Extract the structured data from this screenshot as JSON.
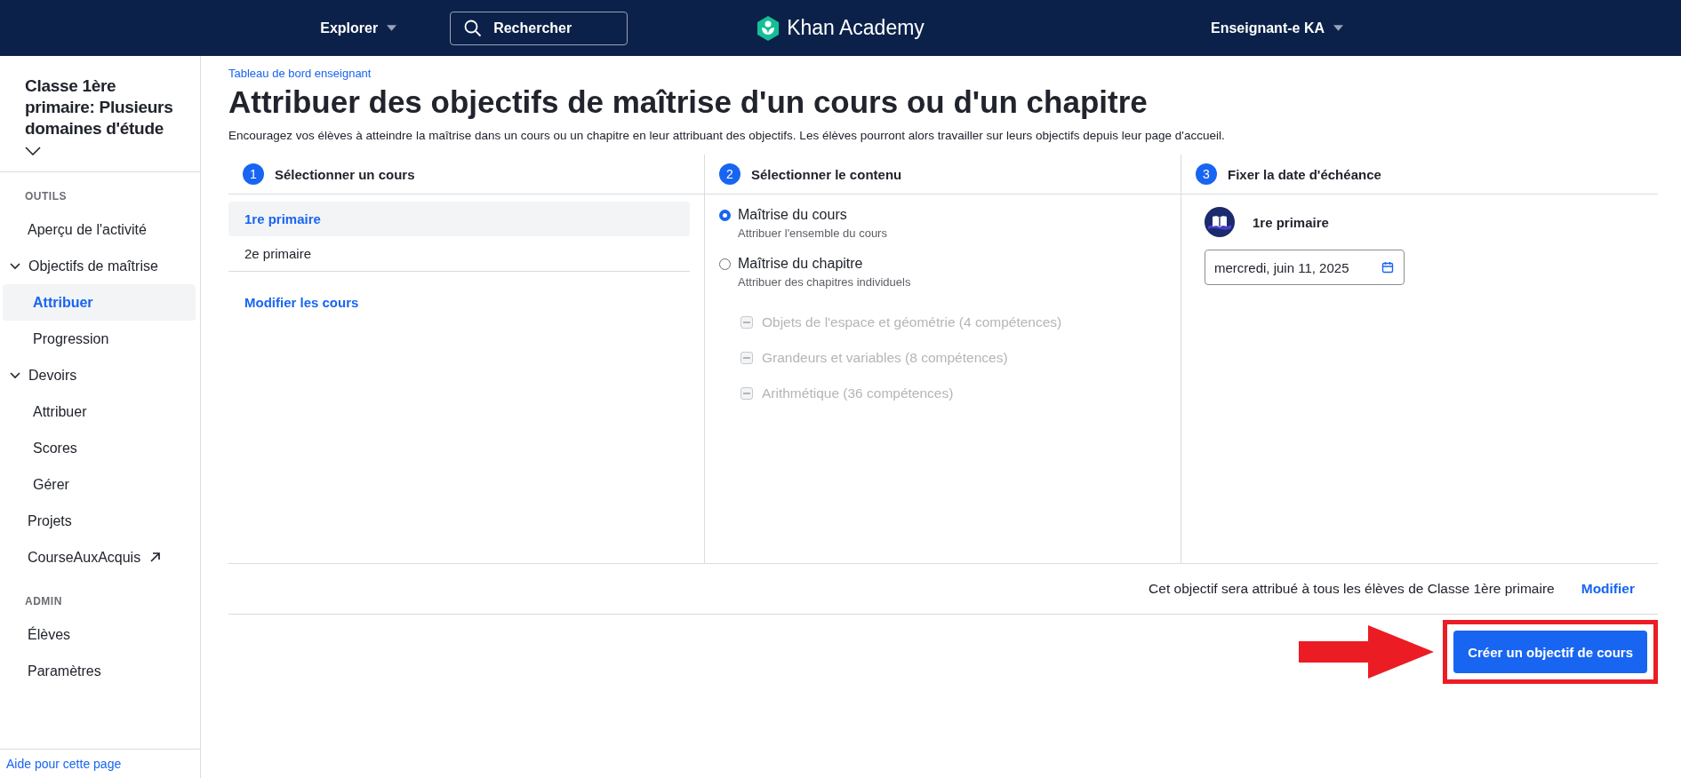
{
  "header": {
    "explore_menu": "Explorer",
    "search": {
      "placeholder": "Rechercher"
    },
    "logo": "Khan Academy",
    "user_menu": "Enseignant-e KA"
  },
  "sidebar": {
    "class_title": "Classe 1ère primaire: Plusieurs domaines d'étude",
    "class_menu_expanded": false,
    "sections": [
      {
        "title": "OUTILS",
        "items": [
          {
            "kind": "link",
            "label": "Aperçu de l'activité",
            "selected": false
          },
          {
            "kind": "group",
            "label": "Objectifs de maîtrise",
            "expanded": true,
            "children": [
              {
                "label": "Attribuer",
                "selected": true
              },
              {
                "label": "Progression",
                "selected": false
              }
            ]
          },
          {
            "kind": "group",
            "label": "Devoirs",
            "expanded": true,
            "children": [
              {
                "label": "Attribuer",
                "selected": false
              },
              {
                "label": "Scores",
                "selected": false
              },
              {
                "label": "Gérer",
                "selected": false
              }
            ]
          },
          {
            "kind": "link",
            "label": "Projets",
            "selected": false
          },
          {
            "kind": "external",
            "label": "CourseAuxAcquis",
            "selected": false
          }
        ]
      },
      {
        "title": "ADMIN",
        "items": [
          {
            "kind": "link",
            "label": "Élèves",
            "selected": false
          },
          {
            "kind": "link",
            "label": "Paramètres",
            "selected": false
          }
        ]
      }
    ],
    "help_link": "Aide pour cette page"
  },
  "main": {
    "breadcrumb": "Tableau de bord enseignant",
    "title": "Attribuer des objectifs de maîtrise d'un cours ou d'un chapitre",
    "description": "Encouragez vos élèves à atteindre la maîtrise dans un cours ou un chapitre en leur attribuant des objectifs. Les élèves pourront alors travailler sur leurs objectifs depuis leur page d'accueil.",
    "steps": [
      {
        "number": "1",
        "title": "Sélectionner un cours"
      },
      {
        "number": "2",
        "title": "Sélectionner le contenu"
      },
      {
        "number": "3",
        "title": "Fixer la date d'échéance"
      }
    ],
    "courses": [
      {
        "label": "1re primaire",
        "selected": true
      },
      {
        "label": "2e primaire",
        "selected": false
      }
    ],
    "modify_courses": "Modifier les cours",
    "content_options": [
      {
        "label": "Maîtrise du cours",
        "description": "Attribuer l'ensemble du cours",
        "selected": true
      },
      {
        "label": "Maîtrise du chapitre",
        "description": "Attribuer des chapitres individuels",
        "selected": false
      }
    ],
    "chapters": [
      {
        "label": "Objets de l'espace et géométrie (4 compétences)",
        "disabled": true
      },
      {
        "label": "Grandeurs et variables (8 compétences)",
        "disabled": true
      },
      {
        "label": "Arithmétique (36 compétences)",
        "disabled": true
      }
    ],
    "due": {
      "course": "1re primaire",
      "date": "mercredi, juin 11, 2025"
    },
    "assignment_note": "Cet objectif sera attribué à tous les élèves de Classe 1ère primaire",
    "modify_link": "Modifier",
    "create_button": "Créer un objectif de cours"
  }
}
